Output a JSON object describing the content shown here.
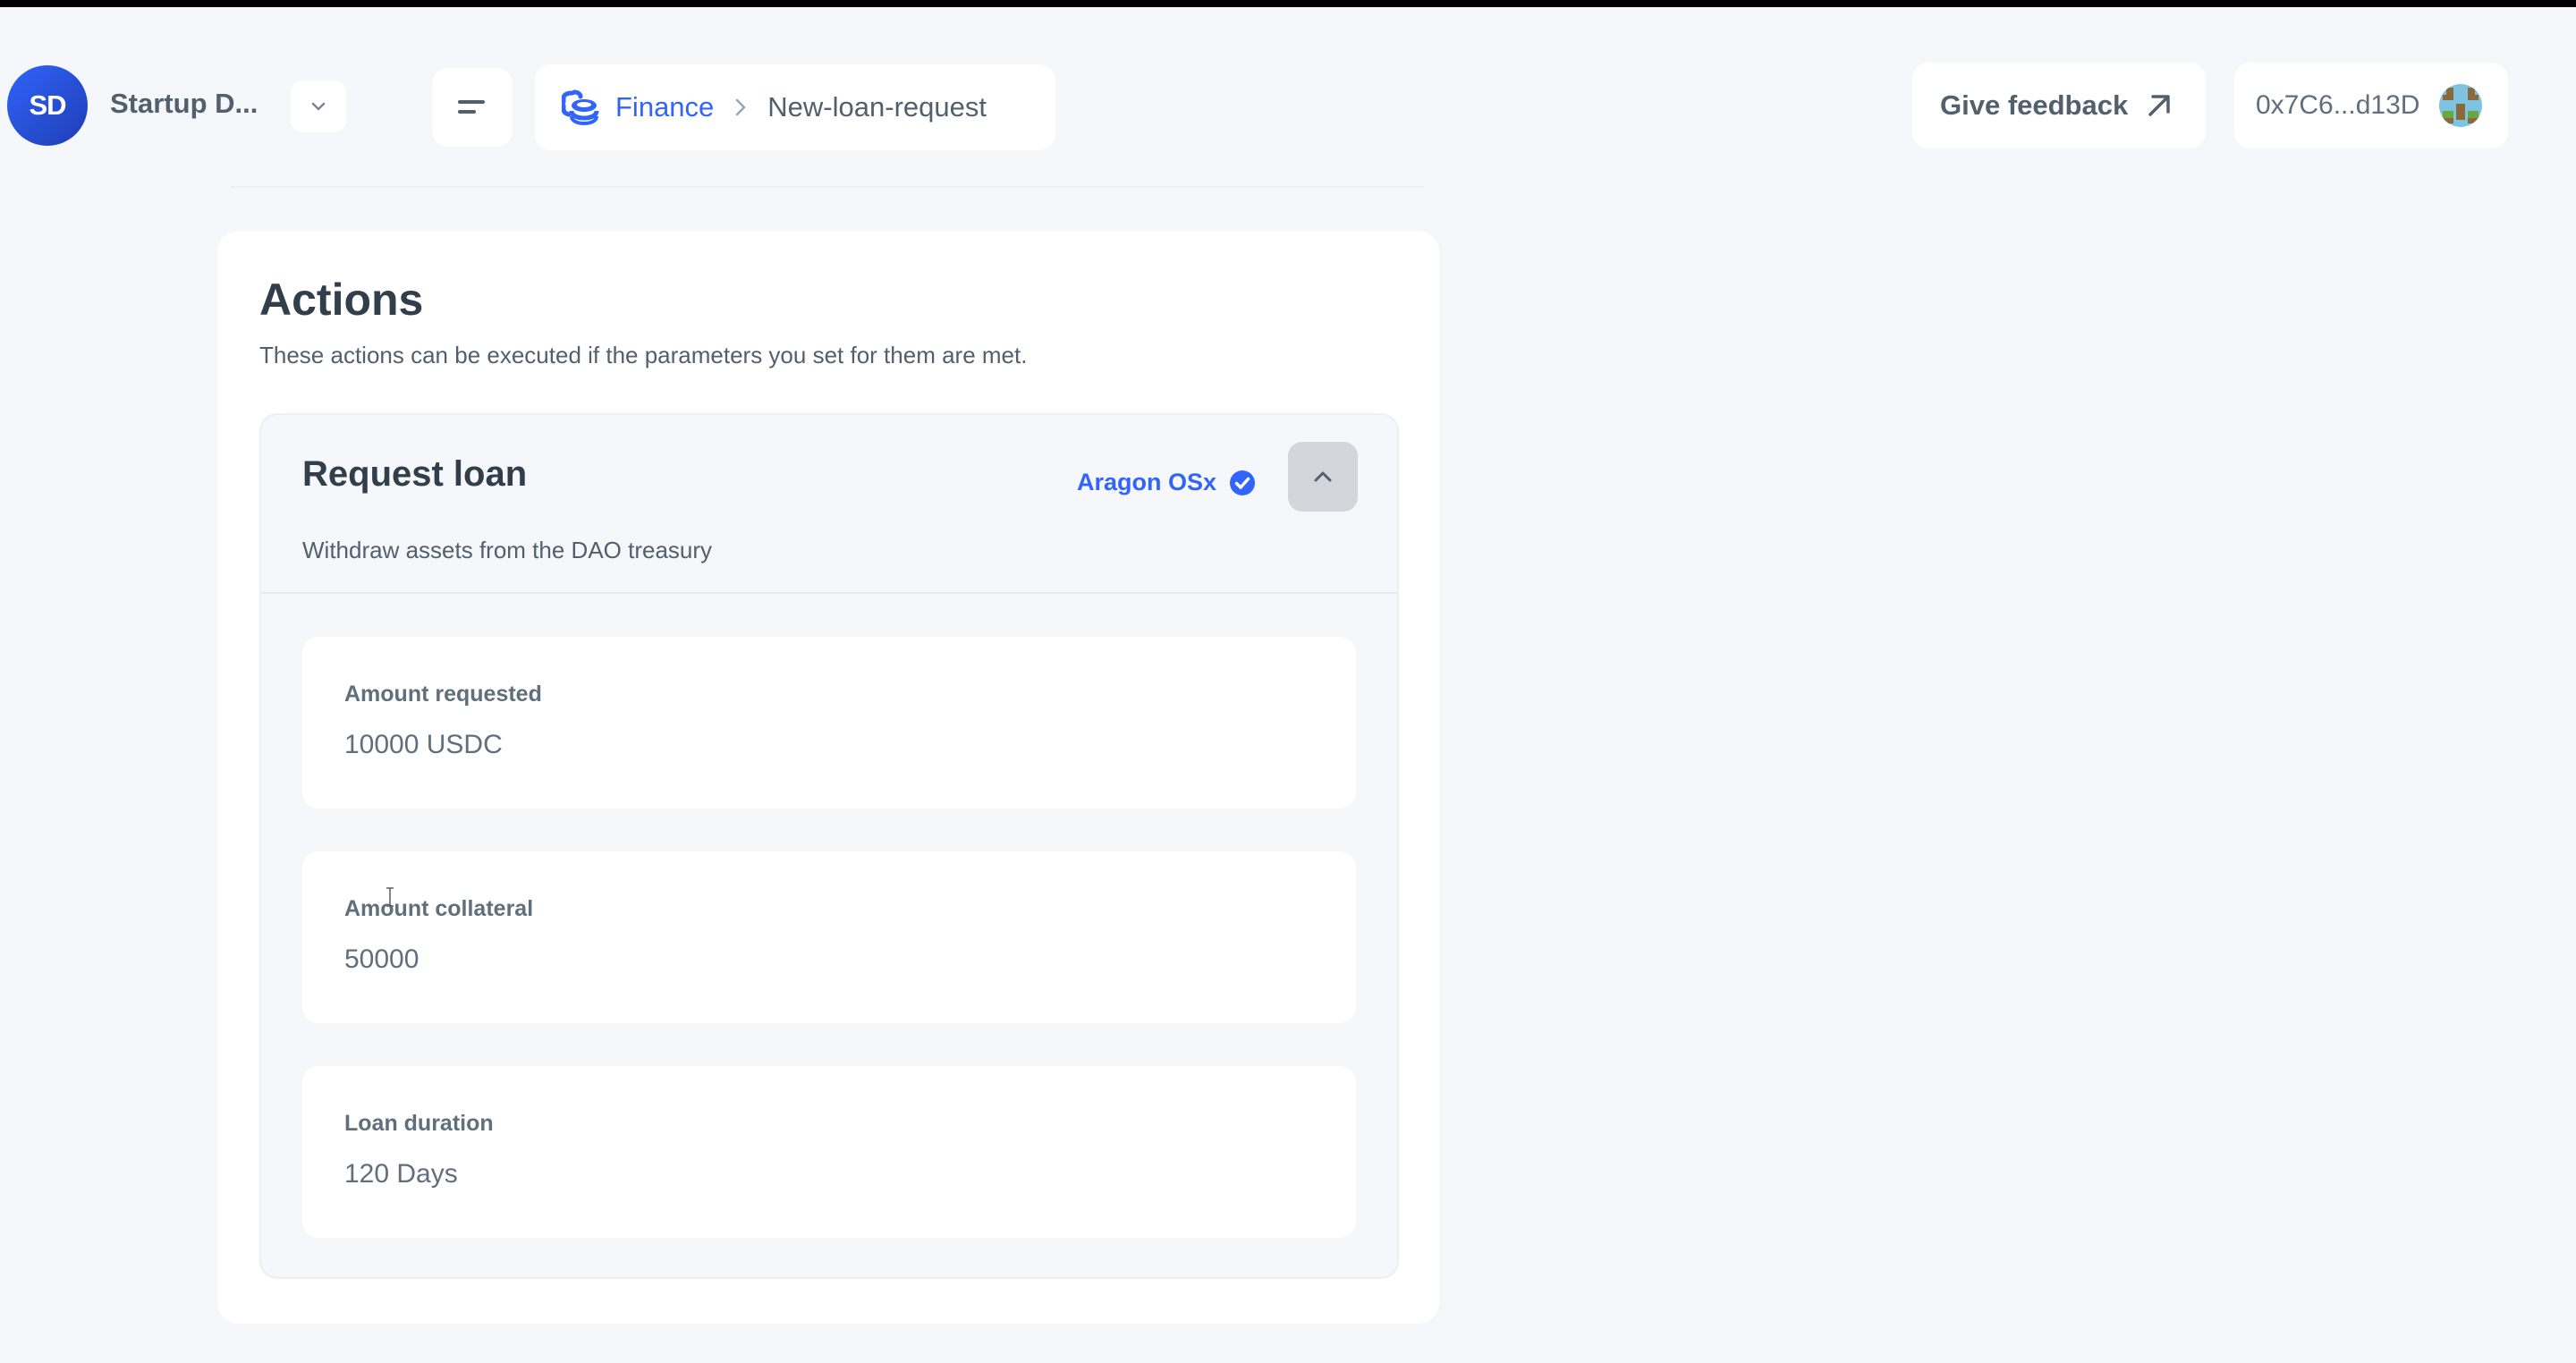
{
  "header": {
    "dao": {
      "initials": "SD",
      "name": "Startup D...",
      "avatar_color": "#3164fa"
    },
    "menu_icon": "menu-lines-icon",
    "breadcrumb": {
      "icon": "coins-stack-icon",
      "items": [
        {
          "label": "Finance",
          "link": true
        },
        {
          "label": "New-loan-request",
          "link": false
        }
      ],
      "separator_icon": "chevron-right-icon"
    },
    "feedback": {
      "label": "Give feedback",
      "icon": "arrow-up-right-icon"
    },
    "wallet": {
      "address": "0x7C6...d13D",
      "icon": "wallet-avatar-blockie"
    }
  },
  "actions": {
    "title": "Actions",
    "subtitle": "These actions can be executed if the parameters you set for them are met.",
    "items": [
      {
        "title": "Request loan",
        "description": "Withdraw assets from the DAO treasury",
        "source": "Aragon OSx",
        "verified": true,
        "expanded": true,
        "fields": [
          {
            "label": "Amount requested",
            "value": "10000 USDC"
          },
          {
            "label": "Amount collateral",
            "value": "50000"
          },
          {
            "label": "Loan duration",
            "value": "120 Days"
          }
        ]
      }
    ]
  },
  "colors": {
    "accent": "#3164fa",
    "background": "#f5f7fa",
    "text": "#52606d",
    "heading": "#323f4b"
  }
}
